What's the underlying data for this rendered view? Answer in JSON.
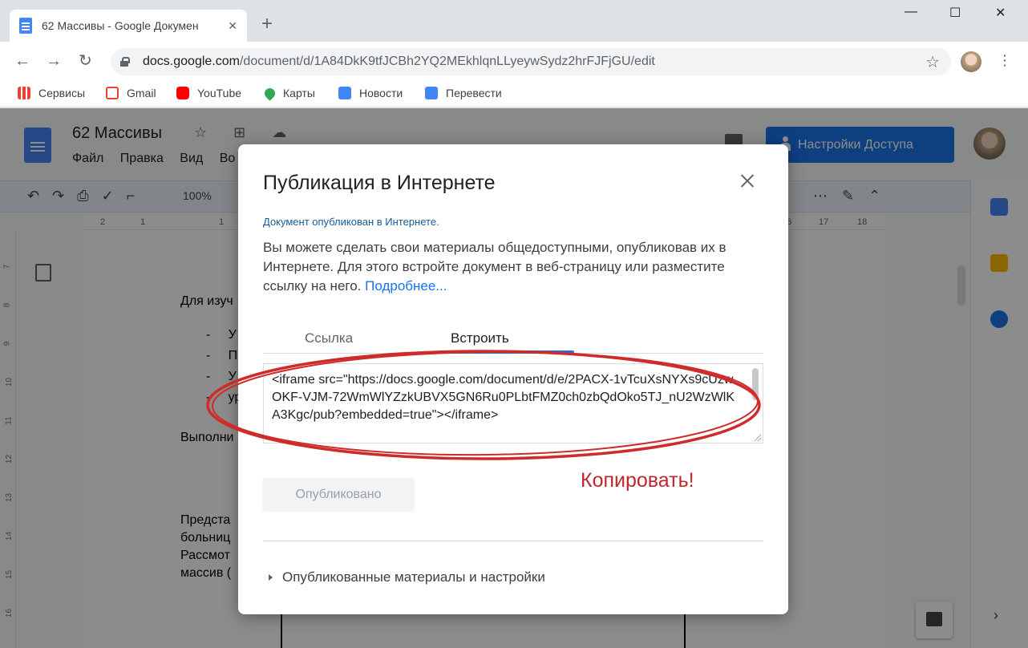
{
  "browser": {
    "tab_title": "62 Массивы - Google Докумен",
    "tab_close": "✕",
    "new_tab": "+",
    "url_host": "docs.google.com",
    "url_path": "/document/d/1A84DkK9tfJCBh2YQ2MEkhlqnLLyeywSydz2hrFJFjGU/edit",
    "window_controls": {
      "minimize": "—",
      "maximize": "☐",
      "close": "✕"
    },
    "nav": {
      "back": "←",
      "forward": "→",
      "reload": "↻"
    },
    "bookmarks": [
      "Сервисы",
      "Gmail",
      "YouTube",
      "Карты",
      "Новости",
      "Перевести"
    ]
  },
  "docs": {
    "title": "62 Массивы",
    "title_icons": "☆ ⊞ ☁",
    "menu": [
      "Файл",
      "Правка",
      "Вид",
      "Во"
    ],
    "share_label": "Настройки Доступа",
    "zoom": "100%",
    "ruler_numbers": [
      "2",
      "1",
      "1",
      "16",
      "17",
      "18"
    ],
    "vruler_numbers": [
      "7",
      "8",
      "9",
      "10",
      "11",
      "12",
      "13",
      "14",
      "15",
      "16"
    ],
    "page_text": {
      "line1": "Для изуч",
      "bullets": [
        "У",
        "П",
        "У",
        "ур"
      ],
      "line2": "Выполни",
      "line3": "Предста",
      "line4": "больниц",
      "line5": "Рассмот",
      "line6": "массив ("
    }
  },
  "dialog": {
    "title": "Публикация в Интернете",
    "status": "Документ опубликован в Интернете.",
    "description": "Вы можете сделать свои материалы общедоступными, опубликовав их в Интернете. Для этого встройте документ в веб-страницу или разместите ссылку на него.",
    "learn_more": "Подробнее...",
    "tabs": {
      "link": "Ссылка",
      "embed": "Встроить"
    },
    "embed_code": "<iframe src=\"https://docs.google.com/document/d/e/2PACX-1vTcuXsNYXs9cUzwOKF-VJM-72WmWlYZzkUBVX5GN6Ru0PLbtFMZ0ch0zbQdOko5TJ_nU2WzWlKA3Kgc/pub?embedded=true\"></iframe>",
    "publish_button": "Опубликовано",
    "copy_note": "Копировать!",
    "published_settings": "Опубликованные материалы и настройки"
  },
  "colors": {
    "accent": "#1a73e8",
    "annotation": "#c0262d"
  }
}
